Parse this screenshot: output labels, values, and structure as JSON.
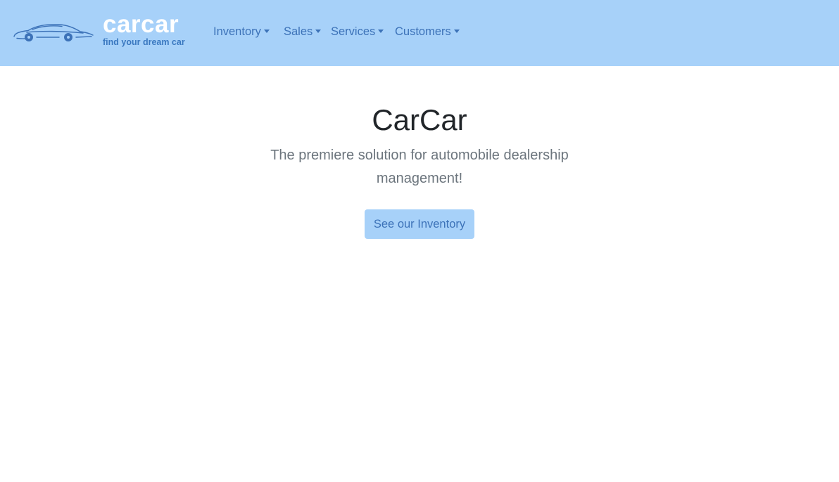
{
  "brand": {
    "name": "carcar",
    "tagline": "find your dream car",
    "logo_icon": "car-icon"
  },
  "nav": {
    "items": [
      {
        "label": "Inventory"
      },
      {
        "label": "Sales"
      },
      {
        "label": "Services"
      },
      {
        "label": "Customers"
      }
    ]
  },
  "hero": {
    "title": "CarCar",
    "lead": "The premiere solution for automobile dealership management!",
    "button_label": "See our Inventory"
  },
  "colors": {
    "navbar_bg": "#a7d1f9",
    "nav_text": "#3c72b8",
    "brand_text": "#ffffff",
    "title_text": "#212529",
    "lead_text": "#6c757d",
    "button_bg": "#a7d1f9"
  }
}
